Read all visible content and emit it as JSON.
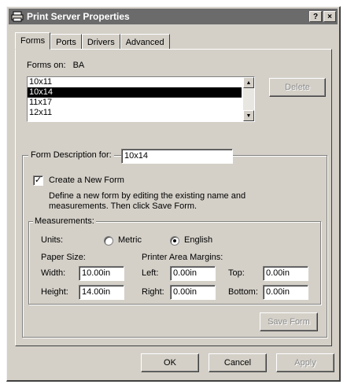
{
  "window": {
    "title": "Print Server Properties",
    "help_label": "?",
    "close_label": "×"
  },
  "tabs": [
    {
      "label": "Forms",
      "active": true
    },
    {
      "label": "Ports",
      "active": false
    },
    {
      "label": "Drivers",
      "active": false
    },
    {
      "label": "Advanced",
      "active": false
    }
  ],
  "forms_on": {
    "label": "Forms on:",
    "server": "BA"
  },
  "forms_list": {
    "items": [
      "10x11",
      "10x14",
      "11x17",
      "12x11"
    ],
    "selected": "10x14"
  },
  "delete_button": {
    "label": "Delete",
    "enabled": false
  },
  "form_description": {
    "label": "Form Description for:",
    "value": "10x14"
  },
  "create_new_form": {
    "label": "Create a New Form",
    "checked": true,
    "help_line1": "Define a new form by editing the existing name and",
    "help_line2": "measurements. Then click Save Form."
  },
  "measurements": {
    "label": "Measurements:",
    "units_label": "Units:",
    "metric_label": "Metric",
    "english_label": "English",
    "selected_unit": "English",
    "paper_size_label": "Paper Size:",
    "margins_label": "Printer Area Margins:",
    "width_label": "Width:",
    "width_value": "10.00in",
    "height_label": "Height:",
    "height_value": "14.00in",
    "left_label": "Left:",
    "left_value": "0.00in",
    "right_label": "Right:",
    "right_value": "0.00in",
    "top_label": "Top:",
    "top_value": "0.00in",
    "bottom_label": "Bottom:",
    "bottom_value": "0.00in"
  },
  "save_form_button": {
    "label": "Save Form",
    "enabled": false
  },
  "dialog_buttons": {
    "ok": "OK",
    "cancel": "Cancel",
    "apply": "Apply"
  }
}
